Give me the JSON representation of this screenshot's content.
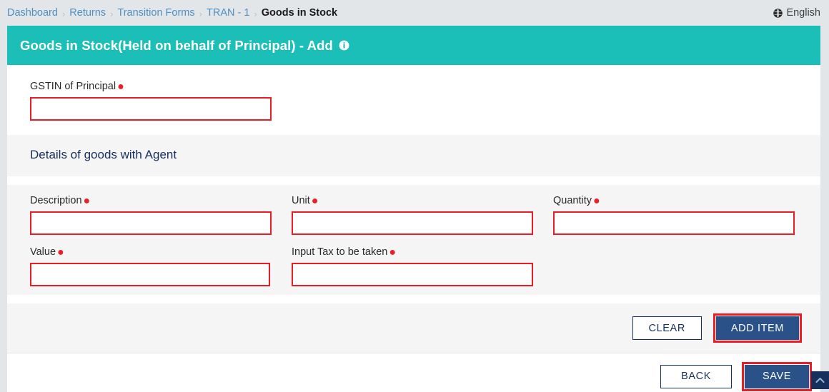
{
  "breadcrumb": {
    "items": [
      {
        "label": "Dashboard",
        "current": false
      },
      {
        "label": "Returns",
        "current": false
      },
      {
        "label": "Transition Forms",
        "current": false
      },
      {
        "label": "TRAN - 1",
        "current": false
      },
      {
        "label": "Goods in Stock",
        "current": true
      }
    ],
    "separator": "›"
  },
  "language": {
    "label": "English",
    "icon": "globe-icon"
  },
  "header": {
    "title": "Goods in Stock(Held on behalf of Principal) - Add",
    "info_icon": "info-circle-icon",
    "background_color": "#1cbfb8"
  },
  "form": {
    "gstin": {
      "label": "GSTIN of Principal",
      "required": true,
      "value": "",
      "placeholder": ""
    },
    "section_title": "Details of goods with Agent",
    "fields": [
      {
        "name": "description",
        "label": "Description",
        "required": true,
        "value": "",
        "placeholder": ""
      },
      {
        "name": "unit",
        "label": "Unit",
        "required": true,
        "value": "",
        "placeholder": ""
      },
      {
        "name": "quantity",
        "label": "Quantity",
        "required": true,
        "value": "",
        "placeholder": ""
      },
      {
        "name": "value",
        "label": "Value",
        "required": true,
        "value": "",
        "placeholder": ""
      },
      {
        "name": "input_tax",
        "label": "Input Tax to be taken",
        "required": true,
        "value": "",
        "placeholder": ""
      }
    ],
    "required_marker": "●"
  },
  "item_actions": {
    "clear_label": "CLEAR",
    "add_item_label": "ADD ITEM"
  },
  "footer_actions": {
    "back_label": "BACK",
    "save_label": "SAVE"
  },
  "scroll_top": {
    "icon": "chevron-up-icon"
  },
  "colors": {
    "teal": "#1cbfb8",
    "navy": "#2b5288",
    "dark_navy": "#16305e",
    "error_red": "#ec1c24",
    "page_bg": "#e3e6e9",
    "panel_gray": "#f5f5f6"
  }
}
